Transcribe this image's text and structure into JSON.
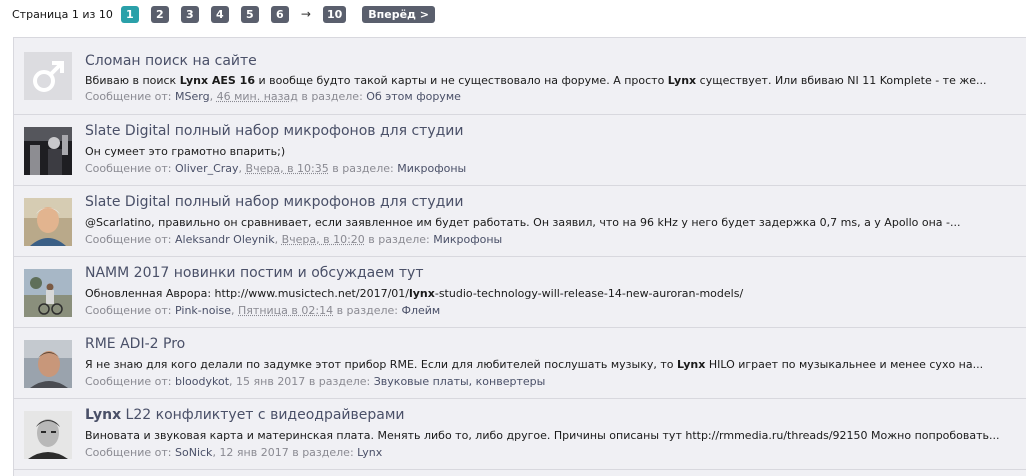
{
  "pager": {
    "label": "Страница 1 из 10",
    "pages": [
      "1",
      "2",
      "3",
      "4",
      "5",
      "6"
    ],
    "arrow": "→",
    "last": "10",
    "next": "Вперёд >"
  },
  "meta_labels": {
    "from": "Сообщение от:",
    "in": "в разделе:"
  },
  "results": [
    {
      "title": "Сломан поиск на сайте",
      "snippet_parts": [
        "Вбиваю в поиск ",
        "Lynx AES 16",
        " и вообще будто такой карты и не существовало на форуме. А просто ",
        "Lynx",
        " существует. Или вбиваю NI 11 Komplete - те же..."
      ],
      "author": "MSerg",
      "date": "46 мин. назад",
      "forum": "Об этом форуме",
      "avatar": "male-symbol-icon"
    },
    {
      "title": "Slate Digital полный набор микрофонов для студии",
      "snippet_parts": [
        "Он сумеет это грамотно впарить;)"
      ],
      "author": "Oliver_Cray",
      "date": "Вчера, в 10:35",
      "forum": "Микрофоны",
      "avatar": "photo-dark"
    },
    {
      "title": "Slate Digital полный набор микрофонов для студии",
      "snippet_parts": [
        "@Scarlatino, правильно он сравнивает, если заявленное им будет работать. Он заявил, что на 96 kHz у него будет задержка 0,7 ms, а у Apollo она -..."
      ],
      "author": "Aleksandr Oleynik",
      "date": "Вчера, в 10:20",
      "forum": "Микрофоны",
      "avatar": "photo-portrait"
    },
    {
      "title": "NAMM 2017 новинки постим и обсуждаем тут",
      "snippet_parts": [
        "Обновленная Аврора: http://www.musictech.net/2017/01/",
        "lynx",
        "-studio-technology-will-release-14-new-auroran-models/"
      ],
      "author": "Pink-noise",
      "date": "Пятница в 02:14",
      "forum": "Флейм",
      "avatar": "photo-outdoor"
    },
    {
      "title": "RME ADI-2 Pro",
      "snippet_parts": [
        "Я не знаю для кого делали по задумке этот прибор RME. Если для любителей послушать музыку, то ",
        "Lynx",
        " HILO играет по музыкальнее и менее сухо на..."
      ],
      "author": "bloodykot",
      "date": "15 янв 2017",
      "forum": "Звуковые платы, конвертеры",
      "avatar": "photo-soft"
    },
    {
      "title_parts": [
        "Lynx",
        " L22 конфликтует с видеодрайверами"
      ],
      "snippet_parts": [
        "Виновата и звуковая карта и материнская плата. Менять либо то, либо другое. Причины описаны тут http://rmmedia.ru/threads/92150 Можно попробовать..."
      ],
      "author": "SoNick",
      "date": "12 янв 2017",
      "forum": "Lynx",
      "avatar": "photo-bw"
    }
  ],
  "colors": {
    "accent": "#2aa0a9",
    "pager": "#5a5f6d",
    "link": "#4a5068"
  }
}
